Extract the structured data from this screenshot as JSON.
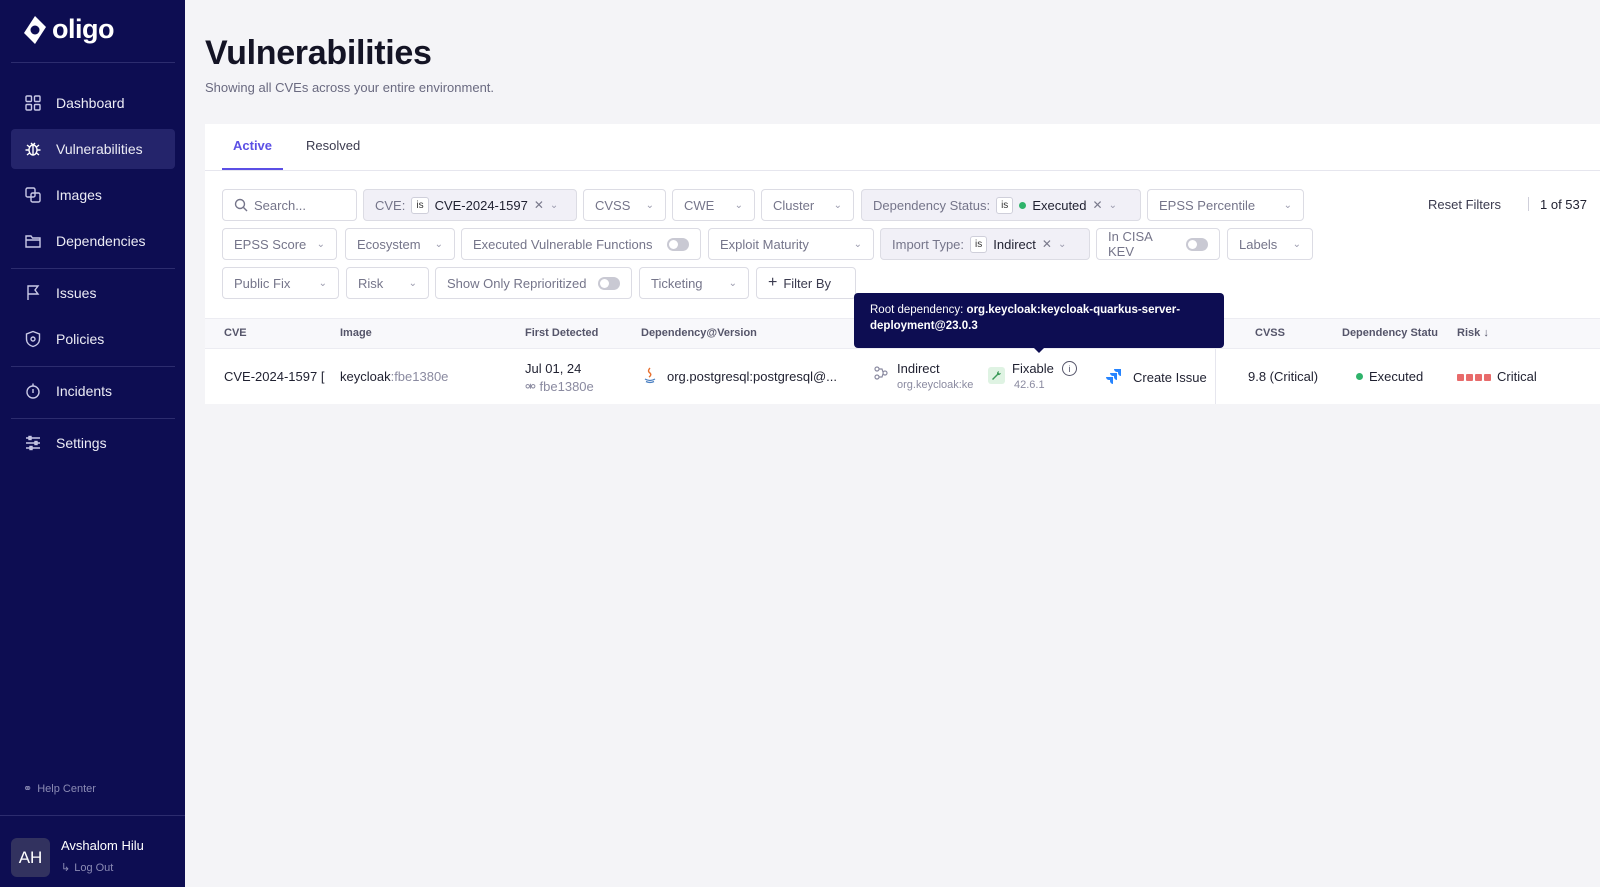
{
  "app": {
    "logo": "oligo"
  },
  "sidebar": {
    "items": [
      {
        "label": "Dashboard"
      },
      {
        "label": "Vulnerabilities"
      },
      {
        "label": "Images"
      },
      {
        "label": "Dependencies"
      },
      {
        "label": "Issues"
      },
      {
        "label": "Policies"
      },
      {
        "label": "Incidents"
      },
      {
        "label": "Settings"
      }
    ],
    "help": "Help Center",
    "user": {
      "initials": "AH",
      "name": "Avshalom Hilu",
      "logout": "Log Out"
    }
  },
  "header": {
    "title": "Vulnerabilities",
    "subtitle": "Showing all CVEs across your entire environment."
  },
  "tabs": [
    {
      "label": "Active"
    },
    {
      "label": "Resolved"
    }
  ],
  "filters": {
    "search_placeholder": "Search...",
    "cve": {
      "label": "CVE:",
      "op": "is",
      "value": "CVE-2024-1597"
    },
    "cvss": "CVSS",
    "cwe": "CWE",
    "cluster": "Cluster",
    "dependency_status": {
      "label": "Dependency Status:",
      "op": "is",
      "value": "Executed"
    },
    "epss_percentile": "EPSS Percentile",
    "epss_score": "EPSS Score",
    "ecosystem": "Ecosystem",
    "executed_vulnerable_functions": "Executed Vulnerable Functions",
    "exploit_maturity": "Exploit Maturity",
    "import_type": {
      "label": "Import Type:",
      "op": "is",
      "value": "Indirect"
    },
    "in_cisa_kev": "In CISA KEV",
    "labels": "Labels",
    "public_fix": "Public Fix",
    "risk": "Risk",
    "show_only_reprioritized": "Show Only Reprioritized",
    "ticketing": "Ticketing",
    "filter_by": "Filter By",
    "reset": "Reset Filters",
    "count": "1 of 537"
  },
  "table": {
    "headers": [
      "CVE",
      "Image",
      "First Detected",
      "Dependency@Version",
      "CVSS",
      "Dependency Statu",
      "Risk"
    ],
    "rows": [
      {
        "cve": "CVE-2024-1597 [",
        "image_name": "keycloak",
        "image_tag": ":fbe1380e",
        "first_detected": "Jul 01, 24",
        "detected_tag": "fbe1380e",
        "dependency": "org.postgresql:postgresql@...",
        "import_type": "Indirect",
        "import_root": "org.keycloak:ke",
        "fix_status": "Fixable",
        "fix_version": "42.6.1",
        "action": "Create Issue",
        "cvss": "9.8 (Critical)",
        "dep_status": "Executed",
        "risk": "Critical"
      }
    ]
  },
  "tooltip": {
    "prefix": "Root dependency: ",
    "value": "org.keycloak:keycloak-quarkus-server-deployment@23.0.3"
  },
  "colors": {
    "sidebar": "#0d0d52",
    "accent": "#5b4fe5",
    "executed": "#2fb36b",
    "critical": "#e86b6b"
  }
}
